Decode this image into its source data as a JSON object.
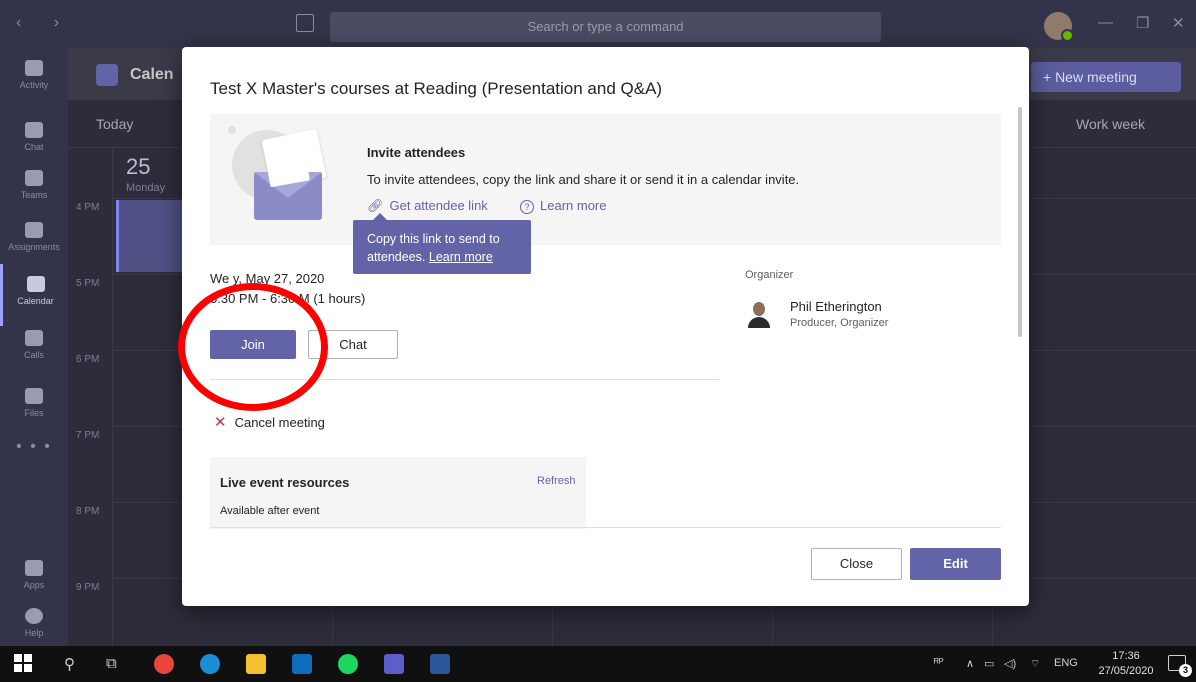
{
  "titlebar": {
    "search_placeholder": "Search or type a command",
    "nav_arrows": "‹ ›",
    "minimize": "—",
    "maximize": "❐",
    "close": "✕"
  },
  "rail": {
    "items": [
      {
        "label": "Activity",
        "icon": "bell-icon"
      },
      {
        "label": "Chat",
        "icon": "chat-icon"
      },
      {
        "label": "Teams",
        "icon": "teams-icon"
      },
      {
        "label": "Assignments",
        "icon": "assignments-icon"
      },
      {
        "label": "Calendar",
        "icon": "calendar-icon",
        "active": true
      },
      {
        "label": "Calls",
        "icon": "phone-icon"
      },
      {
        "label": "Files",
        "icon": "files-icon"
      }
    ],
    "more": "• • •",
    "apps_label": "Apps",
    "help_label": "Help"
  },
  "calendar": {
    "title": "Calen",
    "today_label": "Today",
    "new_meeting_label": "+ New meeting",
    "view_label": "Work week",
    "day_num": "25",
    "day_name": "Monday",
    "hours": [
      "4 PM",
      "5 PM",
      "6 PM",
      "7 PM",
      "8 PM",
      "9 PM"
    ]
  },
  "dialog": {
    "title": "Test X Master's courses at Reading (Presentation and Q&A)",
    "invite": {
      "heading": "Invite attendees",
      "description": "To invite attendees, copy the link and share it or send it in a calendar invite.",
      "get_link_label": "Get attendee link",
      "learn_more_label": "Learn more"
    },
    "tooltip": {
      "line1": "Copy this link to send to",
      "line2": "attendees.",
      "link": "Learn more"
    },
    "date_visible": "We        y, May 27, 2020",
    "time_visible": "5:30 PM - 6:30   M (1 hours)",
    "join_label": "Join",
    "chat_label": "Chat",
    "cancel_label": "Cancel meeting",
    "organizer": {
      "label": "Organizer",
      "name": "Phil Etherington",
      "role": "Producer, Organizer"
    },
    "live_resources": {
      "title": "Live event resources",
      "refresh_label": "Refresh",
      "subtitle": "Available after event"
    },
    "close_label": "Close",
    "edit_label": "Edit"
  },
  "taskbar": {
    "clock_time": "17:36",
    "clock_date": "27/05/2020",
    "language": "ENG",
    "notification_count": "3"
  },
  "colors": {
    "accent": "#6264a7",
    "annotation_red": "#ff0000",
    "rail_bg": "#33344a"
  }
}
